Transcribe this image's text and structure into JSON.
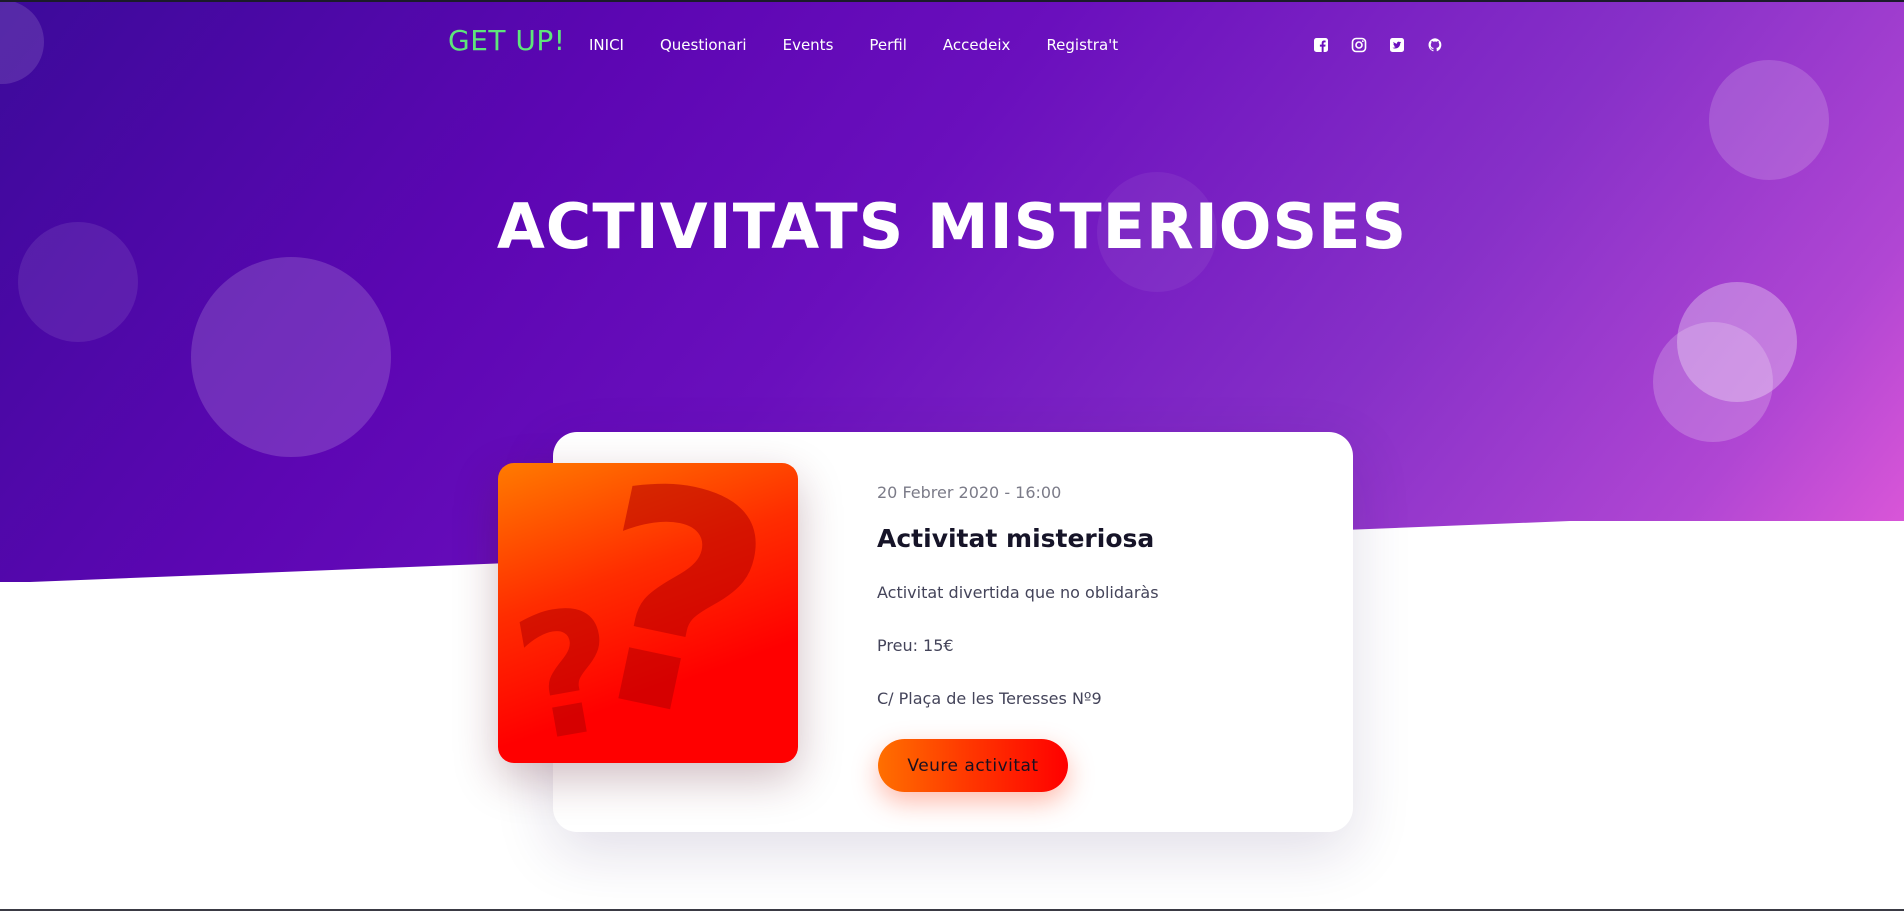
{
  "nav": {
    "logo": "GET UP!",
    "items": [
      {
        "label": "INICI"
      },
      {
        "label": "Questionari"
      },
      {
        "label": "Events"
      },
      {
        "label": "Perfil"
      },
      {
        "label": "Accedeix"
      },
      {
        "label": "Registra't"
      }
    ],
    "social_icons": [
      "facebook-icon",
      "instagram-icon",
      "twitter-icon",
      "github-icon"
    ]
  },
  "hero": {
    "title": "ACTIVITATS MISTERIOSES"
  },
  "card": {
    "date": "20 Febrer 2020 - 16:00",
    "title": "Activitat misteriosa",
    "description": "Activitat divertida que no oblidaràs",
    "price": "Preu: 15€",
    "address": "C/ Plaça de les Teresses Nº9",
    "button_label": "Veure activitat",
    "image_icon": "question-mark-icon"
  },
  "colors": {
    "logo": "#5ee67a",
    "hero_gradient_start": "#3c0a9a",
    "hero_gradient_end": "#e45ad9",
    "button_gradient_start": "#ff6f00",
    "button_gradient_end": "#ff0000",
    "image_gradient_start": "#ff7b00",
    "image_gradient_end": "#ff0000"
  }
}
